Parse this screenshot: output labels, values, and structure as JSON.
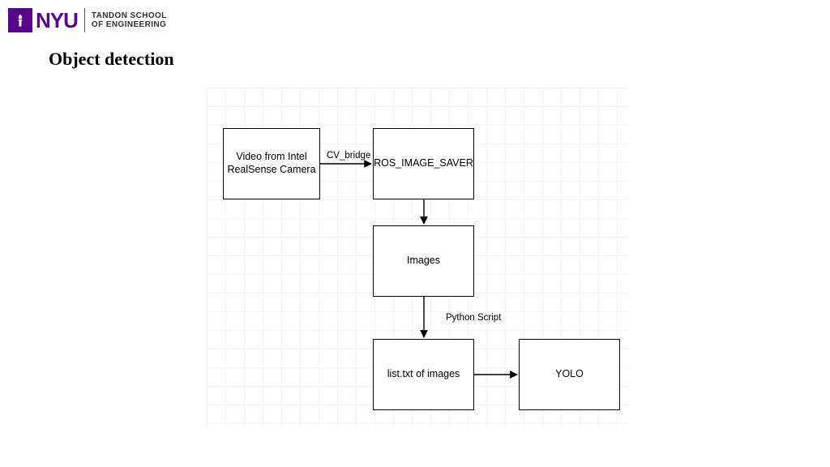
{
  "header": {
    "brand": "NYU",
    "school_line1": "TANDON SCHOOL",
    "school_line2": "OF ENGINEERING"
  },
  "title": "Object detection",
  "diagram": {
    "nodes": {
      "source": {
        "text": "Video from Intel RealSense Camera"
      },
      "saver": {
        "text": "ROS_IMAGE_SAVER"
      },
      "images": {
        "text": "Images"
      },
      "listtxt": {
        "text": "list.txt of images"
      },
      "yolo": {
        "text": "YOLO"
      }
    },
    "edges": {
      "e1": {
        "text": "CV_bridge"
      },
      "e2": {
        "text": ""
      },
      "e3": {
        "text": "Python Script"
      },
      "e4": {
        "text": ""
      }
    }
  }
}
